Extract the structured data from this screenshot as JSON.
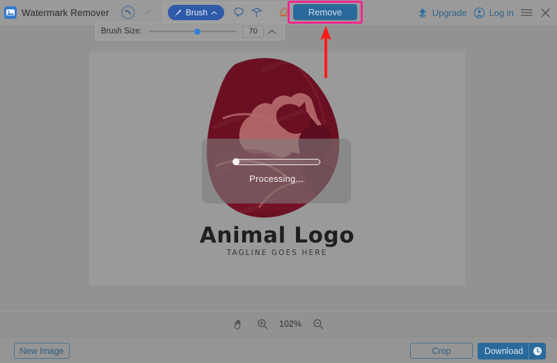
{
  "window": {
    "title": "Watermark Remover",
    "app_icon": "image-app-icon"
  },
  "toolbar": {
    "undo_icon": "undo-icon",
    "redo_icon": "redo-icon",
    "brush_label": "Brush",
    "brush_icon": "brush-icon",
    "brush_chevron": "chevron-up-icon",
    "lasso_icon": "lasso-icon",
    "polygon_lasso_icon": "polygon-lasso-icon",
    "eraser_icon": "eraser-icon",
    "remove_label": "Remove"
  },
  "header_right": {
    "upgrade_label": "Upgrade",
    "upgrade_icon": "upload-arrow-icon",
    "login_label": "Log in",
    "login_icon": "user-circle-icon",
    "menu_icon": "hamburger-menu-icon",
    "close_icon": "close-icon"
  },
  "brush_panel": {
    "label": "Brush Size:",
    "value": "70",
    "min": 1,
    "max": 128,
    "thumb_percent": 55,
    "collapse_icon": "chevron-up-icon"
  },
  "canvas": {
    "logo": {
      "title": "Animal Logo",
      "tagline": "TAGLINE GOES HERE",
      "colors": {
        "dark_maroon": "#6b1022",
        "mid_maroon": "#8d2030",
        "rose": "#b56a6a",
        "deep_shadow": "#4a0c18"
      }
    }
  },
  "processing": {
    "label": "Processing...",
    "progress_percent": 3
  },
  "annotation": {
    "arrow_color": "#ff1a1a",
    "highlight_color": "#f0268f"
  },
  "zoombar": {
    "hand_icon": "hand-tool-icon",
    "zoom_in_icon": "zoom-in-icon",
    "zoom_level": "102%",
    "zoom_out_icon": "zoom-out-icon"
  },
  "footer": {
    "new_image_label": "New Image",
    "crop_label": "Crop",
    "download_label": "Download",
    "download_history_icon": "clock-history-icon"
  }
}
